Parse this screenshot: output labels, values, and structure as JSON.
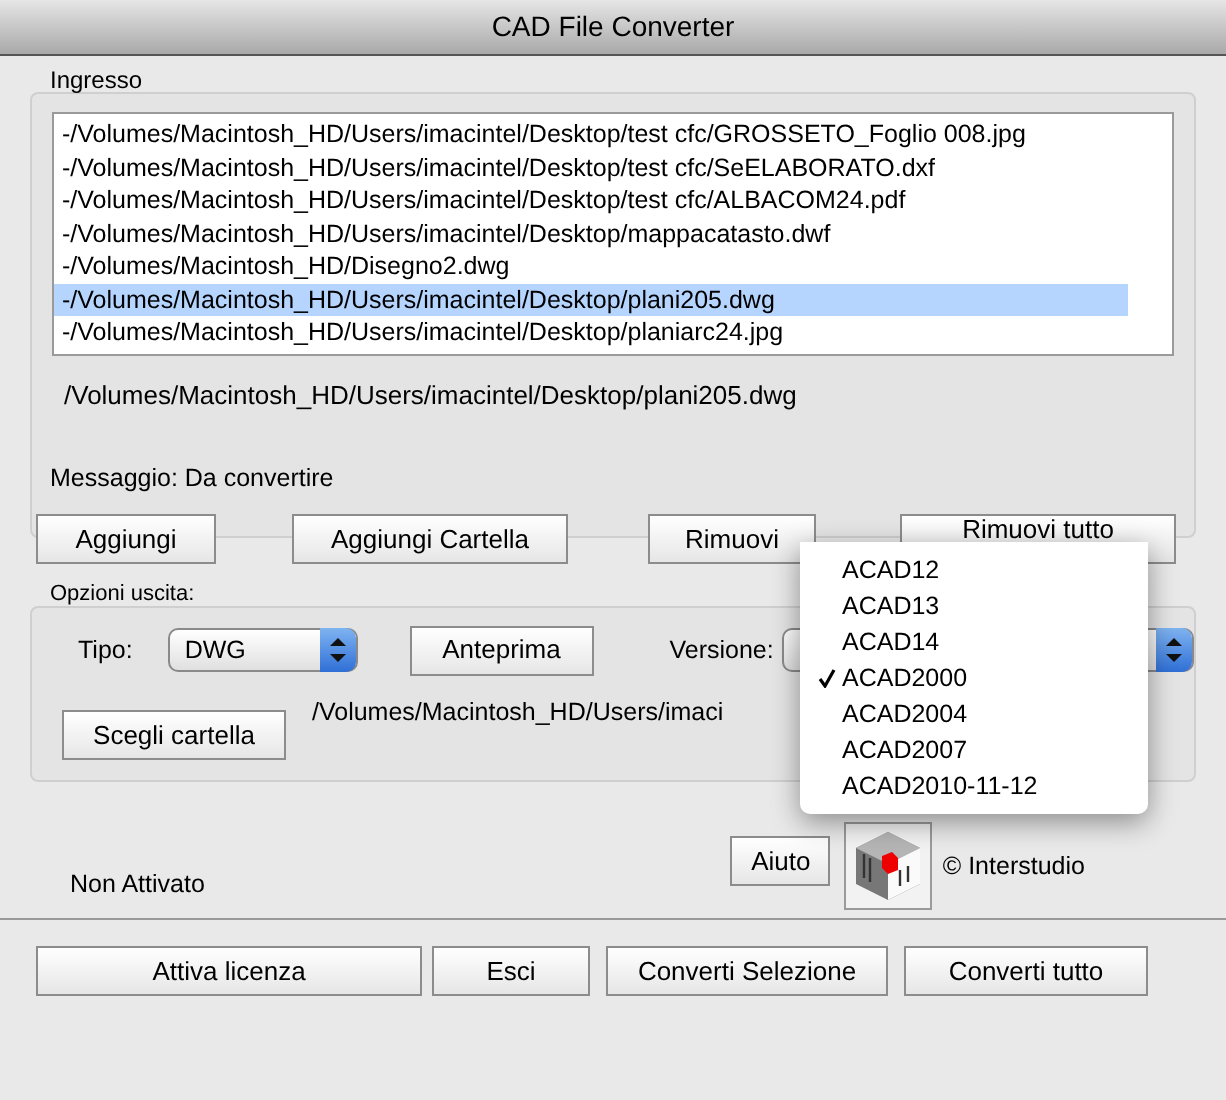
{
  "window": {
    "title": "CAD File Converter"
  },
  "input": {
    "label": "Ingresso",
    "files": [
      {
        "path": "-/Volumes/Macintosh_HD/Users/imacintel/Desktop/test cfc/GROSSETO_Foglio 008.jpg",
        "selected": false
      },
      {
        "path": "-/Volumes/Macintosh_HD/Users/imacintel/Desktop/test cfc/SeELABORATO.dxf",
        "selected": false
      },
      {
        "path": "-/Volumes/Macintosh_HD/Users/imacintel/Desktop/test cfc/ALBACOM24.pdf",
        "selected": false
      },
      {
        "path": "-/Volumes/Macintosh_HD/Users/imacintel/Desktop/mappacatasto.dwf",
        "selected": false
      },
      {
        "path": "-/Volumes/Macintosh_HD/Disegno2.dwg",
        "selected": false
      },
      {
        "path": "-/Volumes/Macintosh_HD/Users/imacintel/Desktop/plani205.dwg",
        "selected": true
      },
      {
        "path": "-/Volumes/Macintosh_HD/Users/imacintel/Desktop/planiarc24.jpg",
        "selected": false
      }
    ],
    "current_path": "/Volumes/Macintosh_HD/Users/imacintel/Desktop/plani205.dwg",
    "message": "Messaggio: Da convertire",
    "buttons": [
      "Aggiungi",
      "Aggiungi Cartella",
      "Rimuovi",
      "Rimuovi tutto"
    ]
  },
  "output": {
    "label": "Opzioni uscita:",
    "type_label": "Tipo:",
    "type_value": "DWG",
    "preview_button": "Anteprima",
    "version_label": "Versione:",
    "folder_button": "Scegli cartella",
    "folder_path": "/Volumes/Macintosh_HD/Users/imaci"
  },
  "version_menu": {
    "items": [
      {
        "label": "ACAD12",
        "checked": false
      },
      {
        "label": "ACAD13",
        "checked": false
      },
      {
        "label": "ACAD14",
        "checked": false
      },
      {
        "label": "ACAD2000",
        "checked": true
      },
      {
        "label": "ACAD2004",
        "checked": false
      },
      {
        "label": "ACAD2007",
        "checked": false
      },
      {
        "label": "ACAD2010-11-12",
        "checked": false
      }
    ]
  },
  "help_button": "Aiuto",
  "copyright": "© Interstudio",
  "license_status": "Non Attivato",
  "buttons": [
    "Attiva licenza",
    "Esci",
    "Converti Selezione",
    "Converti tutto"
  ]
}
